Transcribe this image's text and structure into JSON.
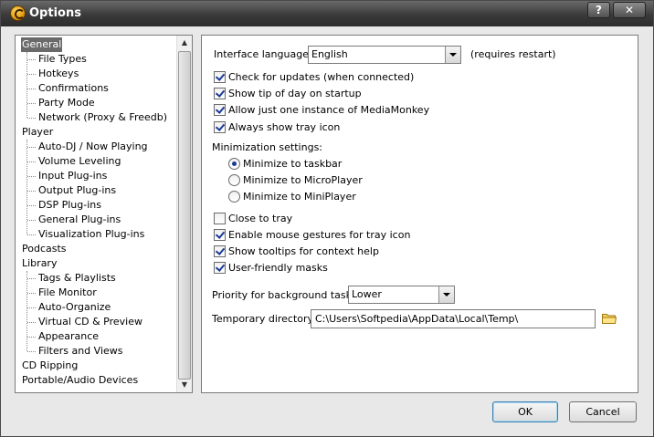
{
  "window": {
    "title": "Options",
    "help_label": "?",
    "close_label": "✕"
  },
  "sidebar": {
    "items": [
      {
        "label": "General",
        "level": 0,
        "selected": true
      },
      {
        "label": "File Types",
        "level": 1
      },
      {
        "label": "Hotkeys",
        "level": 1
      },
      {
        "label": "Confirmations",
        "level": 1
      },
      {
        "label": "Party Mode",
        "level": 1
      },
      {
        "label": "Network (Proxy & Freedb)",
        "level": 1
      },
      {
        "label": "Player",
        "level": 0
      },
      {
        "label": "Auto-DJ / Now Playing",
        "level": 1
      },
      {
        "label": "Volume Leveling",
        "level": 1
      },
      {
        "label": "Input Plug-ins",
        "level": 1
      },
      {
        "label": "Output Plug-ins",
        "level": 1
      },
      {
        "label": "DSP Plug-ins",
        "level": 1
      },
      {
        "label": "General Plug-ins",
        "level": 1
      },
      {
        "label": "Visualization Plug-ins",
        "level": 1
      },
      {
        "label": "Podcasts",
        "level": 0
      },
      {
        "label": "Library",
        "level": 0
      },
      {
        "label": "Tags & Playlists",
        "level": 1
      },
      {
        "label": "File Monitor",
        "level": 1
      },
      {
        "label": "Auto-Organize",
        "level": 1
      },
      {
        "label": "Virtual CD & Preview",
        "level": 1
      },
      {
        "label": "Appearance",
        "level": 1
      },
      {
        "label": "Filters and Views",
        "level": 1
      },
      {
        "label": "CD Ripping",
        "level": 0
      },
      {
        "label": "Portable/Audio Devices",
        "level": 0
      }
    ]
  },
  "general": {
    "language_label": "Interface language:",
    "language_value": "English",
    "restart_note": "(requires restart)",
    "check_updates": "Check for updates (when connected)",
    "tip_of_day": "Show tip of day on startup",
    "one_instance": "Allow just one instance of MediaMonkey",
    "tray_icon": "Always show tray icon",
    "minimization_label": "Minimization settings:",
    "min_taskbar": "Minimize to taskbar",
    "min_microplayer": "Minimize to MicroPlayer",
    "min_miniplayer": "Minimize to MiniPlayer",
    "close_to_tray": "Close to tray",
    "mouse_gestures": "Enable mouse gestures for tray icon",
    "tooltips": "Show tooltips for context help",
    "user_masks": "User-friendly masks",
    "priority_label": "Priority for background tasks:",
    "priority_value": "Lower",
    "tempdir_label": "Temporary directory:",
    "tempdir_value": "C:\\Users\\Softpedia\\AppData\\Local\\Temp\\"
  },
  "buttons": {
    "ok": "OK",
    "cancel": "Cancel"
  }
}
